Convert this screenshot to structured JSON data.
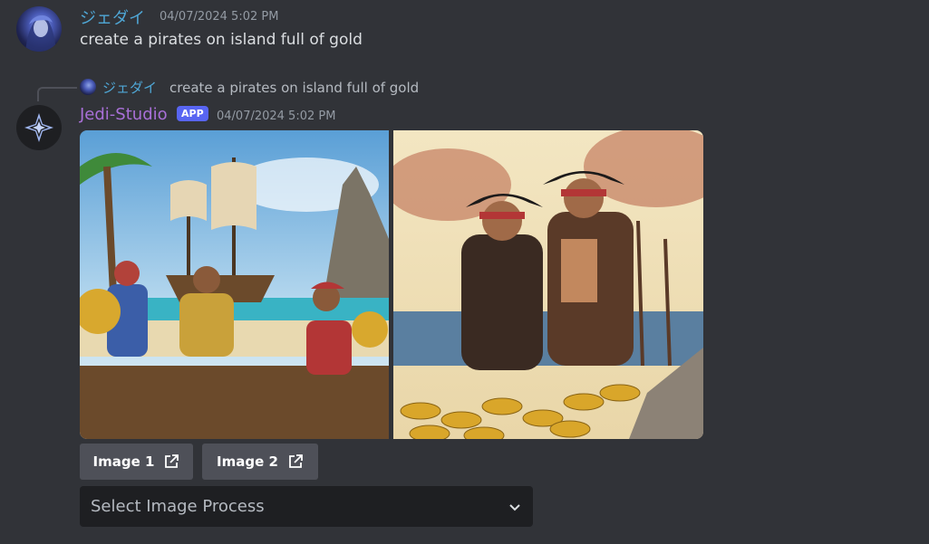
{
  "user_message": {
    "username": "ジェダイ",
    "timestamp": "04/07/2024 5:02 PM",
    "content": "create a pirates on island full of gold"
  },
  "reply_preview": {
    "username": "ジェダイ",
    "text": "create a pirates on island full of gold"
  },
  "bot_message": {
    "username": "Jedi-Studio",
    "badge": "APP",
    "timestamp": "04/07/2024 5:02 PM"
  },
  "buttons": [
    {
      "label": "Image 1",
      "icon": "external-link-icon"
    },
    {
      "label": "Image 2",
      "icon": "external-link-icon"
    }
  ],
  "select": {
    "placeholder": "Select Image Process",
    "icon": "chevron-down-icon"
  },
  "colors": {
    "background": "#313338",
    "user_name": "#4fa7d6",
    "bot_name": "#a970d8",
    "badge": "#5865f2",
    "button": "#4e5058",
    "select_bg": "#1e1f22"
  }
}
